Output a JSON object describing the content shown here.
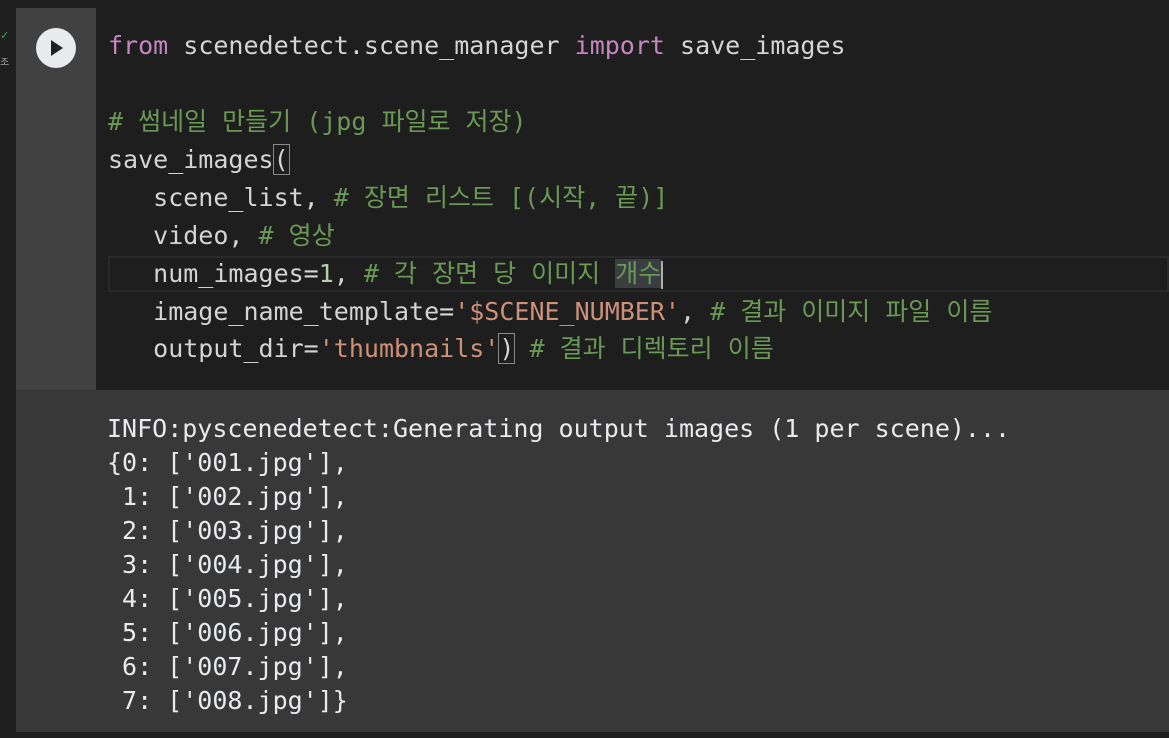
{
  "exec_status": {
    "check_icon": "✓",
    "time_label": "초"
  },
  "code": {
    "line1": {
      "kw1": "from",
      "module": "scenedetect.scene_manager",
      "kw2": "import",
      "name": "save_images"
    },
    "line3": {
      "comment": "# 썸네일 만들기 (jpg 파일로 저장)"
    },
    "line4": {
      "func": "save_images",
      "paren": "("
    },
    "line5": {
      "arg": "scene_list,",
      "comment": "# 장면 리스트 [(시작, 끝)]"
    },
    "line6": {
      "arg": "video,",
      "comment": "# 영상"
    },
    "line7": {
      "arg": "num_images=",
      "num": "1",
      "sep": ",",
      "comment_a": "# 각 장면 당 이미지 ",
      "comment_b": "개수"
    },
    "line8": {
      "arg": "image_name_template=",
      "str": "'$SCENE_NUMBER'",
      "sep": ",",
      "comment": "# 결과 이미지 파일 이름"
    },
    "line9": {
      "arg": "output_dir=",
      "str": "'thumbnails'",
      "paren": ")",
      "comment": "# 결과 디렉토리 이름"
    }
  },
  "output": {
    "lines": [
      "INFO:pyscenedetect:Generating output images (1 per scene)...",
      "{0: ['001.jpg'],",
      " 1: ['002.jpg'],",
      " 2: ['003.jpg'],",
      " 3: ['004.jpg'],",
      " 4: ['005.jpg'],",
      " 5: ['006.jpg'],",
      " 6: ['007.jpg'],",
      " 7: ['008.jpg']}"
    ]
  }
}
